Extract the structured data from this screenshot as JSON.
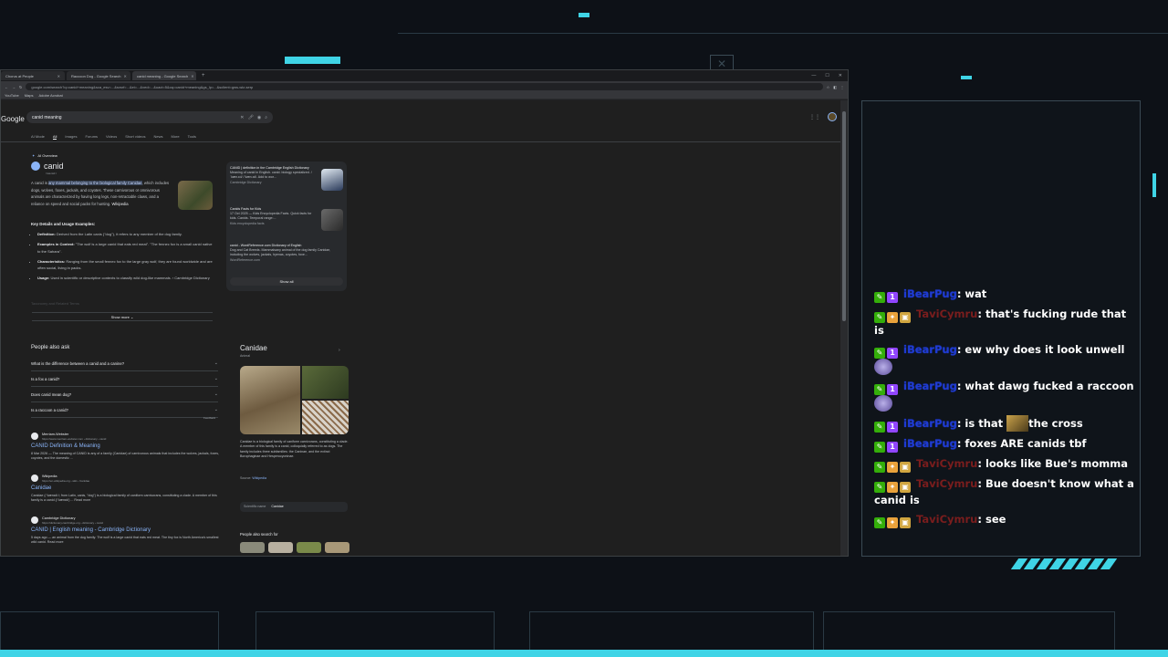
{
  "browser": {
    "tabs": [
      {
        "label": "Chorus at People",
        "active": false
      },
      {
        "label": "Raccoon Dog - Google Search",
        "active": false
      },
      {
        "label": "canid meaning - Google Search",
        "active": true
      }
    ],
    "new_tab": "+",
    "url": "google.com/search?q=canid+meaning&sca_esv=...&sxsrf=...&ei=...&ved=...&uact=5&oq=canid+meaning&gs_lp=...&sclient=gws-wiz-serp",
    "bookmarks": [
      "YouTube",
      "Maps",
      "Adobe Acrobat"
    ]
  },
  "search": {
    "logo": "Google",
    "query": "canid meaning",
    "filters": [
      "AI Mode",
      "All",
      "Images",
      "Forums",
      "Videos",
      "Short videos",
      "News",
      "More",
      "Tools"
    ]
  },
  "ai_overview": {
    "header": "AI Overview",
    "entity": "canid",
    "entity_sub": "/ kænɪd /",
    "para_pre": "A canid is ",
    "para_hl": "any mammal belonging to the biological family Canidae",
    "para_post": ", which includes dogs, wolves, foxes, jackals, and coyotes. These carnivorous or omnivorous animals are characterized by having long legs, non-retractable claws, and a reliance on speed and social packs for hunting.",
    "para_cite": "Wikipedia",
    "key_title": "Key Details and Usage Examples:",
    "bullets": [
      {
        "label": "Definition:",
        "text": " Derived from the Latin canis (\"dog\"), it refers to any member of the dog family."
      },
      {
        "label": "Examples in Context:",
        "text": " \"The wolf is a large canid that eats red meat\". \"The fennec fox is a small canid native to the Sahara\"."
      },
      {
        "label": "Characteristics:",
        "text": " Ranging from the small fennec fox to the large gray wolf, they are found worldwide and are often social, living in packs."
      },
      {
        "label": "Usage:",
        "text": " Used in scientific or descriptive contexts to classify wild dog-like mammals. › Cambridge Dictionary"
      }
    ],
    "faded_heading": "Taxonomy and Related Terms",
    "show_more": "Show more"
  },
  "sources": [
    {
      "title": "CANID | definition in the Cambridge English Dictionary",
      "snippet": "Meaning of canid in English. canid. biology specialized. /ˈkæn.ɪd/ /ˈkæn.ɪd/. Add to wor...",
      "site": "Cambridge Dictionary"
    },
    {
      "title": "Canids Facts for Kids",
      "snippet": "17 Oct 2025 — Kids Encyclopedia Facts. Quick facts for kids. Canids. Temporal range:...",
      "site": "Kids encyclopedia facts"
    },
    {
      "title": "canid - WordReference.com Dictionary of English",
      "snippet": "Dog and Cat Breeds. Mammalsany animal of the dog family Canidae, including the wolves, jackals, hyenas, coyotes, foxe...",
      "site": "WordReference.com"
    }
  ],
  "show_all": "Show all",
  "people_also_ask": {
    "title": "People also ask",
    "questions": [
      "What is the difference between a canid and a canine?",
      "Is a fox a canid?",
      "Does canid mean dog?",
      "Is a raccoon a canid?"
    ],
    "feedback": "Feedback"
  },
  "results": [
    {
      "site": "Merriam-Webster",
      "url": "https://www.merriam-webster.com › dictionary › canid",
      "title": "CANID Definition & Meaning",
      "snippet": "8 Mar 2026 — The meaning of CANID is any of a family (Canidae) of carnivorous animals that includes the wolves, jackals, foxes, coyotes, and the domestic ..."
    },
    {
      "site": "Wikipedia",
      "url": "https://en.wikipedia.org › wiki › Canidae",
      "title": "Canidae",
      "snippet": "Canidae (/ˈkænɪdiː/; from Latin, canis, \"dog\") is a biological family of caniform carnivorans, constituting a clade. A member of this family is a canid (/ˈkænɪd/) ... Read more"
    },
    {
      "site": "Cambridge Dictionary",
      "url": "https://dictionary.cambridge.org › dictionary › canid",
      "title": "CANID | English meaning - Cambridge Dictionary",
      "snippet": "5 days ago — an animal from the dog family: The wolf is a large canid that eats red meat. The tiny fox is North America's smallest wild canid. Read more"
    }
  ],
  "knowledge_panel": {
    "title": "Canidae",
    "subtitle": "Animal",
    "description": "Canidae is a biological family of caniform carnivorans, constituting a clade. A member of this family is a canid, colloquially referred to as dogs. The family includes three subfamilies: the Caninae, and the extinct Borophaginae and Hesperocyoninae.",
    "source_label": "Source:",
    "source_link": "Wikipedia",
    "sci_label": "Scientific name",
    "sci_value": "Canidae",
    "pasf": "People also search for"
  },
  "chat": [
    {
      "badges": [
        "mod",
        "sub"
      ],
      "user": "iBearPug",
      "user_color": "blue",
      "text": "wat"
    },
    {
      "badges": [
        "mod",
        "vip",
        "gift"
      ],
      "user": "TaviCymru",
      "user_color": "red",
      "text": "that's fucking rude that is"
    },
    {
      "badges": [
        "mod",
        "sub"
      ],
      "user": "iBearPug",
      "user_color": "blue",
      "text": "ew why does it look unwell"
    },
    {
      "badges": [
        "mod",
        "sub"
      ],
      "user": "iBearPug",
      "user_color": "blue",
      "text": "what dawg fucked a raccoon"
    },
    {
      "badges": [
        "mod",
        "sub"
      ],
      "user": "iBearPug",
      "user_color": "blue",
      "text_pre": "is that",
      "text": "the cross"
    },
    {
      "badges": [
        "mod",
        "sub"
      ],
      "user": "iBearPug",
      "user_color": "blue",
      "text": "foxes ARE canids tbf"
    },
    {
      "badges": [
        "mod",
        "vip",
        "gift"
      ],
      "user": "TaviCymru",
      "user_color": "red",
      "text": "looks like Bue's momma"
    },
    {
      "badges": [
        "mod",
        "vip",
        "gift"
      ],
      "user": "TaviCymru",
      "user_color": "red",
      "text": "Bue doesn't know what a canid is"
    },
    {
      "badges": [
        "mod",
        "vip",
        "gift"
      ],
      "user": "TaviCymru",
      "user_color": "red",
      "text": "see"
    }
  ],
  "colors": {
    "accent": "#3fd4e6",
    "link": "#8ab4f8",
    "page_bg": "#1f1f1f"
  }
}
